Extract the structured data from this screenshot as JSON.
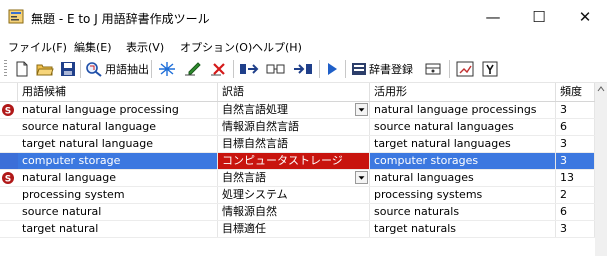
{
  "window": {
    "title": "無題 - E to J 用語辞書作成ツール",
    "minimize_glyph": "—",
    "maximize_glyph": "☐",
    "close_glyph": "✕"
  },
  "menu": [
    {
      "label": "ファイル(F)"
    },
    {
      "label": "編集(E)"
    },
    {
      "label": "表示(V)"
    },
    {
      "label": "オプション(O)"
    },
    {
      "label": "ヘルプ(H)"
    }
  ],
  "toolbar": {
    "extract_label": "用語抽出",
    "register_label": "辞書登録",
    "icons": [
      "new-file-icon",
      "open-folder-icon",
      "save-icon",
      "term-extract-icon",
      "star-icon",
      "edit-icon",
      "delete-icon",
      "insert-before-icon",
      "split-icon",
      "insert-after-icon",
      "run-icon",
      "dictionary-register-icon",
      "chart-icon",
      "window-icon",
      "help-icon"
    ]
  },
  "table": {
    "columns": [
      "用語候補",
      "訳語",
      "活用形",
      "頻度"
    ],
    "rows": [
      {
        "candidate": "natural language processing",
        "translation": "自然言語処理",
        "inflection": "natural language processings",
        "frequency": "3",
        "badge": true,
        "dropdown": true,
        "selected": false
      },
      {
        "candidate": "source natural language",
        "translation": "情報源自然言語",
        "inflection": "source natural languages",
        "frequency": "6",
        "badge": false,
        "dropdown": false,
        "selected": false
      },
      {
        "candidate": "target natural language",
        "translation": "目標自然言語",
        "inflection": "target natural languages",
        "frequency": "3",
        "badge": false,
        "dropdown": false,
        "selected": false
      },
      {
        "candidate": "computer storage",
        "translation": "コンピュータストレージ",
        "inflection": "computer storages",
        "frequency": "3",
        "badge": false,
        "dropdown": false,
        "selected": true
      },
      {
        "candidate": "natural language",
        "translation": "自然言語",
        "inflection": "natural languages",
        "frequency": "13",
        "badge": true,
        "dropdown": true,
        "selected": false
      },
      {
        "candidate": "processing system",
        "translation": "処理システム",
        "inflection": "processing systems",
        "frequency": "2",
        "badge": false,
        "dropdown": false,
        "selected": false
      },
      {
        "candidate": "source natural",
        "translation": "情報源自然",
        "inflection": "source naturals",
        "frequency": "6",
        "badge": false,
        "dropdown": false,
        "selected": false
      },
      {
        "candidate": "target natural",
        "translation": "目標適任",
        "inflection": "target naturals",
        "frequency": "3",
        "badge": false,
        "dropdown": false,
        "selected": false
      }
    ]
  },
  "colors": {
    "selection_row": "#3c6fd8",
    "selection_translation": "#c8140e",
    "badge": "#b01818"
  }
}
